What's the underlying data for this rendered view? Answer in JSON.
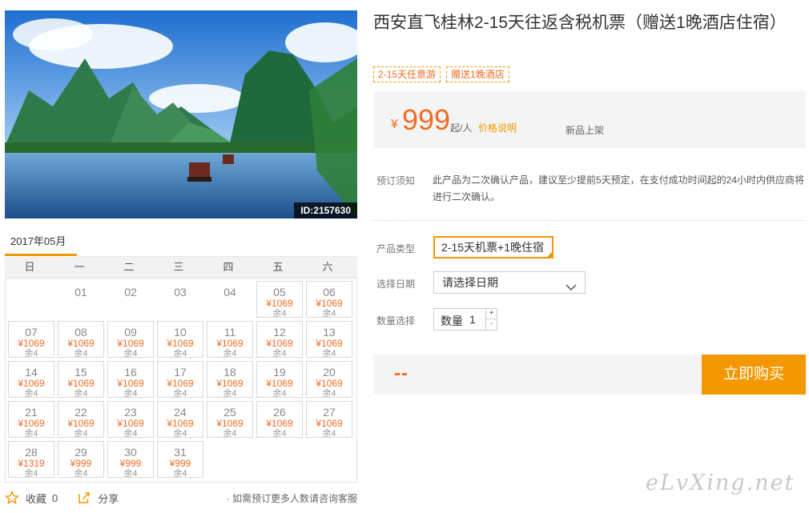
{
  "product": {
    "title": "西安直飞桂林2-15天往返含税机票（赠送1晚酒店住宿）",
    "image_id": "ID:2157630",
    "tags": [
      "2-15天任意游",
      "赠送1晚酒店"
    ]
  },
  "price": {
    "currency": "¥",
    "amount": "999",
    "unit": "起/人",
    "explain_link": "价格说明",
    "status": "新品上架"
  },
  "booking": {
    "notice_label": "预订须知",
    "notice_text": "此产品为二次确认产品，建议至少提前5天预定，在支付成功时间起的24小时内供应商将进行二次确认。",
    "type_label": "产品类型",
    "type_value": "2-15天机票+1晚住宿",
    "date_label": "选择日期",
    "date_value": "请选择日期",
    "qty_label": "数量选择",
    "qty_prefix": "数量",
    "qty_value": "1",
    "plus": "+",
    "minus": "-",
    "total_placeholder": "--",
    "buy_label": "立即购买"
  },
  "calendar": {
    "month": "2017年05月",
    "weekdays": [
      "日",
      "一",
      "二",
      "三",
      "四",
      "五",
      "六"
    ],
    "days": [
      {
        "date": "01",
        "price": "",
        "stock": ""
      },
      {
        "date": "02",
        "price": "",
        "stock": ""
      },
      {
        "date": "03",
        "price": "",
        "stock": ""
      },
      {
        "date": "04",
        "price": "",
        "stock": ""
      },
      {
        "date": "05",
        "price": "¥1069",
        "stock": "余4"
      },
      {
        "date": "06",
        "price": "¥1069",
        "stock": "余4"
      },
      {
        "date": "07",
        "price": "¥1069",
        "stock": "余4"
      },
      {
        "date": "08",
        "price": "¥1069",
        "stock": "余4"
      },
      {
        "date": "09",
        "price": "¥1069",
        "stock": "余4"
      },
      {
        "date": "10",
        "price": "¥1069",
        "stock": "余4"
      },
      {
        "date": "11",
        "price": "¥1069",
        "stock": "余4"
      },
      {
        "date": "12",
        "price": "¥1069",
        "stock": "余4"
      },
      {
        "date": "13",
        "price": "¥1069",
        "stock": "余4"
      },
      {
        "date": "14",
        "price": "¥1069",
        "stock": "余4"
      },
      {
        "date": "15",
        "price": "¥1069",
        "stock": "余4"
      },
      {
        "date": "16",
        "price": "¥1069",
        "stock": "余4"
      },
      {
        "date": "17",
        "price": "¥1069",
        "stock": "余4"
      },
      {
        "date": "18",
        "price": "¥1069",
        "stock": "余4"
      },
      {
        "date": "19",
        "price": "¥1069",
        "stock": "余4"
      },
      {
        "date": "20",
        "price": "¥1069",
        "stock": "余4"
      },
      {
        "date": "21",
        "price": "¥1069",
        "stock": "余4"
      },
      {
        "date": "22",
        "price": "¥1069",
        "stock": "余4"
      },
      {
        "date": "23",
        "price": "¥1069",
        "stock": "余4"
      },
      {
        "date": "24",
        "price": "¥1069",
        "stock": "余4"
      },
      {
        "date": "25",
        "price": "¥1069",
        "stock": "余4"
      },
      {
        "date": "26",
        "price": "¥1069",
        "stock": "余4"
      },
      {
        "date": "27",
        "price": "¥1069",
        "stock": "余4"
      },
      {
        "date": "28",
        "price": "¥1319",
        "stock": "余4"
      },
      {
        "date": "29",
        "price": "¥999",
        "stock": "余4"
      },
      {
        "date": "30",
        "price": "¥999",
        "stock": "余4"
      },
      {
        "date": "31",
        "price": "¥999",
        "stock": "余4"
      }
    ]
  },
  "actions": {
    "favorite_label": "收藏",
    "favorite_count": "0",
    "share_label": "分享",
    "note": "· 如需预订更多人数请咨询客服"
  },
  "watermark": "eLvXing.net",
  "colors": {
    "accent": "#f39800",
    "price": "#f36c21"
  }
}
